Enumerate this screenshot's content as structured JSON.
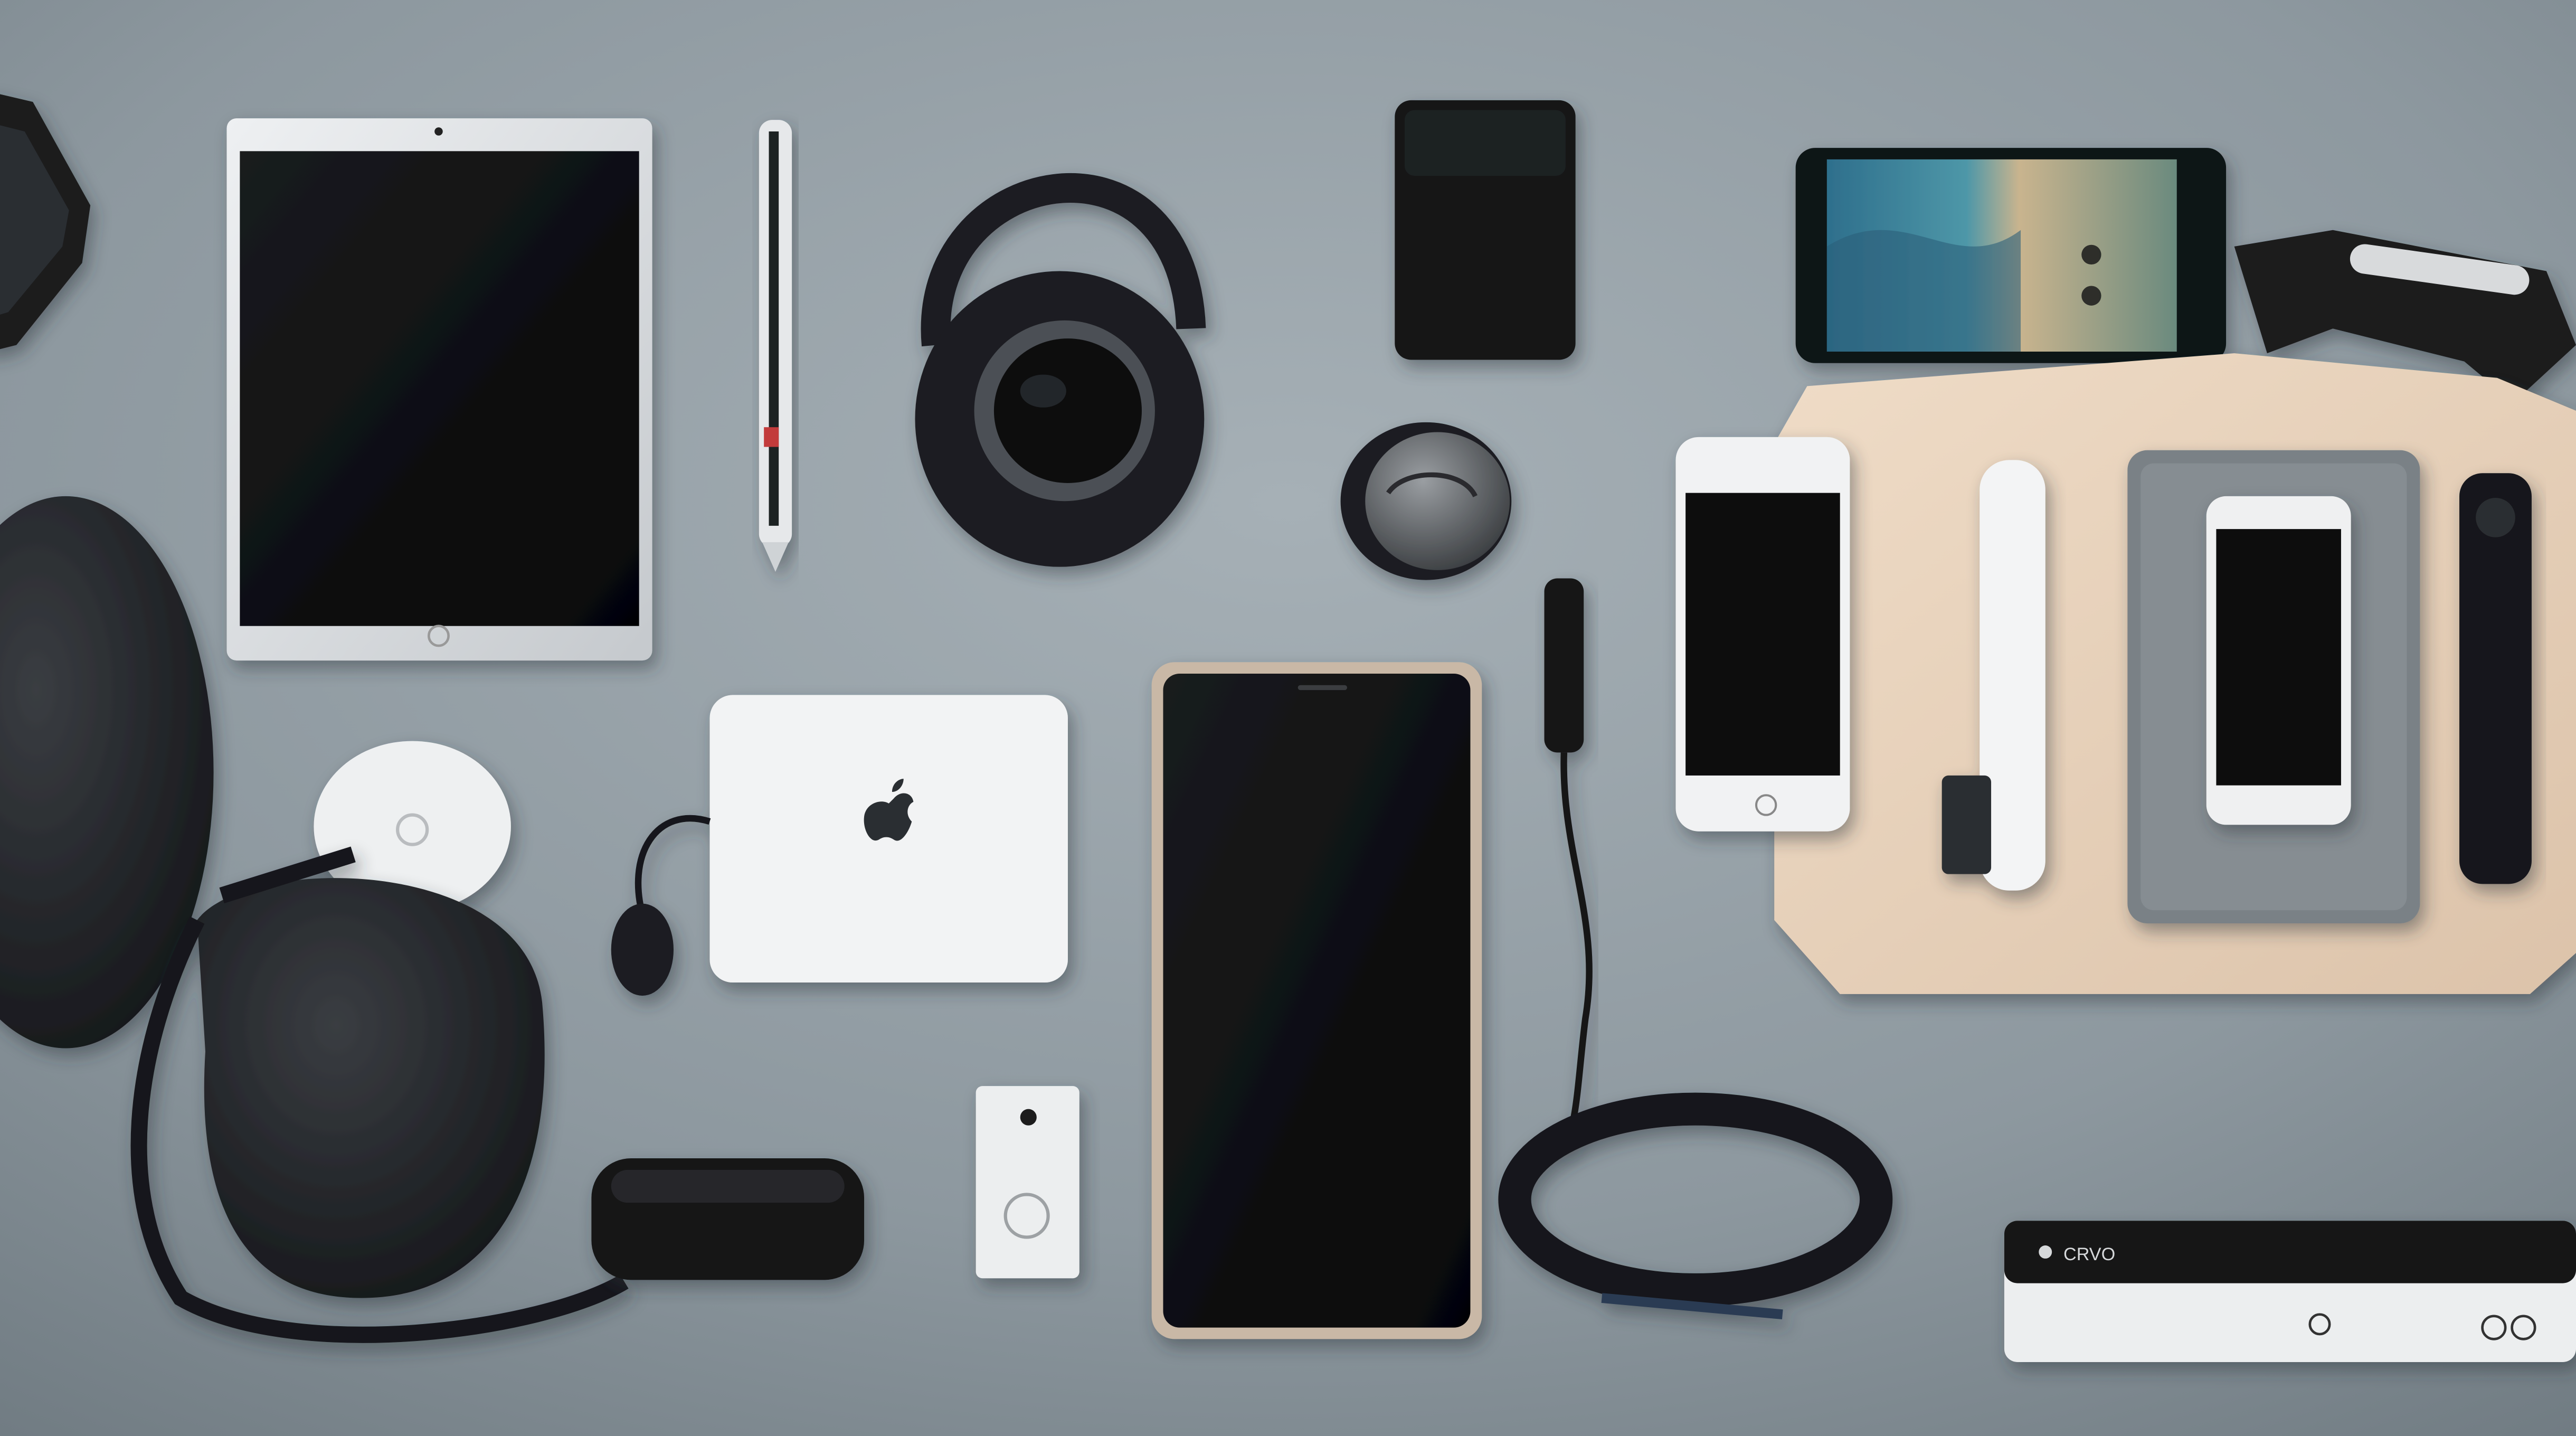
{
  "scene": {
    "description_free": true,
    "printed_text": {
      "bar_label": "CRVO"
    },
    "colors": {
      "background": "#8f9aa1",
      "background_light": "#a3adb3",
      "background_dark": "#6f7a81",
      "device_black": "#0a0b0d",
      "device_silver": "#d9dcdf",
      "wood": "#e8d3bd",
      "white_device": "#f1f2f3"
    },
    "icons": [
      "apple-logo-icon",
      "home-button-icon",
      "power-symbol-icon"
    ]
  }
}
